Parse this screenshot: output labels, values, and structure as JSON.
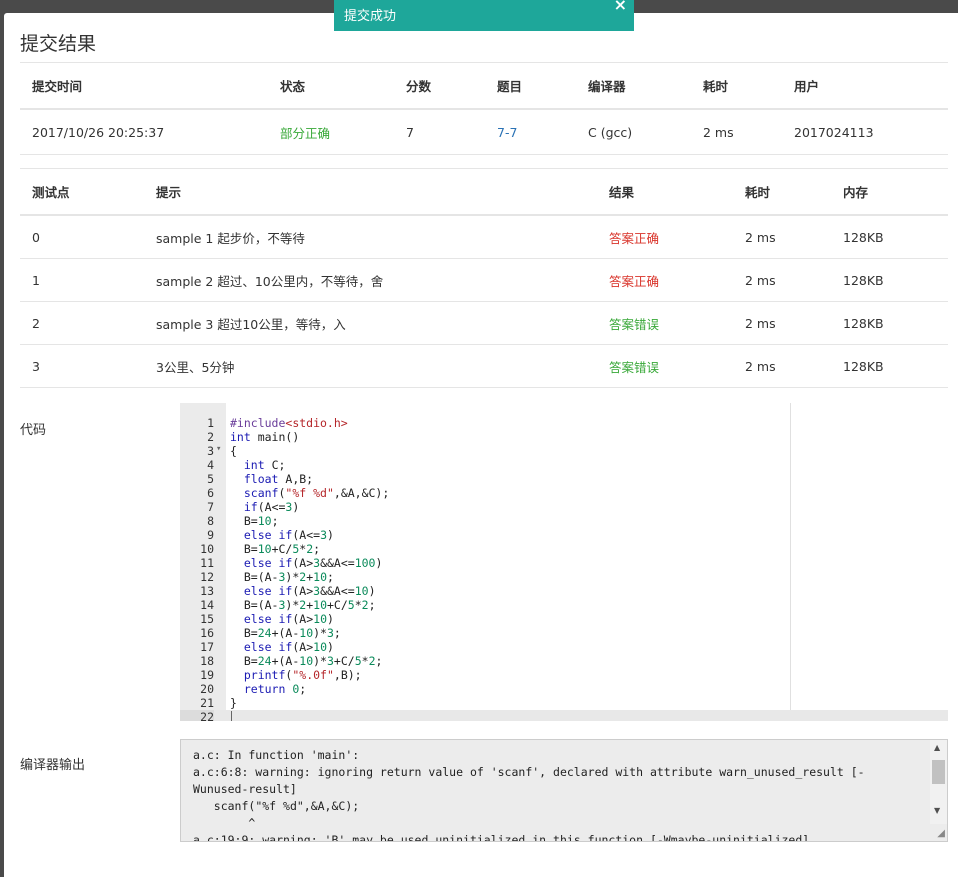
{
  "toast": {
    "text": "提交成功",
    "close": "×"
  },
  "title": "提交结果",
  "summary": {
    "headers": [
      "提交时间",
      "状态",
      "分数",
      "题目",
      "编译器",
      "耗时",
      "用户"
    ],
    "row": {
      "time": "2017/10/26 20:25:37",
      "status": "部分正确",
      "score": "7",
      "problem": "7-7",
      "compiler": "C (gcc)",
      "duration": "2 ms",
      "user": "2017024113"
    }
  },
  "tests": {
    "headers": [
      "测试点",
      "提示",
      "结果",
      "耗时",
      "内存"
    ],
    "rows": [
      {
        "id": "0",
        "hint": "sample 1 起步价，不等待",
        "result": "答案正确",
        "time": "2 ms",
        "mem": "128KB"
      },
      {
        "id": "1",
        "hint": "sample 2 超过、10公里内，不等待，舍",
        "result": "答案正确",
        "time": "2 ms",
        "mem": "128KB"
      },
      {
        "id": "2",
        "hint": "sample 3 超过10公里，等待，入",
        "result": "答案错误",
        "time": "2 ms",
        "mem": "128KB"
      },
      {
        "id": "3",
        "hint": "3公里、5分钟",
        "result": "答案错误",
        "time": "2 ms",
        "mem": "128KB"
      }
    ]
  },
  "labels": {
    "code": "代码",
    "compiler_output": "编译器输出"
  },
  "code_lines": [
    "#include<stdio.h>",
    "int main()",
    "{",
    "  int C;",
    "  float A,B;",
    "  scanf(\"%f %d\",&A,&C);",
    "  if(A<=3)",
    "  B=10;",
    "  else if(A<=3)",
    "  B=10+C/5*2;",
    "  else if(A>3&&A<=100)",
    "  B=(A-3)*2+10;",
    "  else if(A>3&&A<=10)",
    "  B=(A-3)*2+10+C/5*2;",
    "  else if(A>10)",
    "  B=24+(A-10)*3;",
    "  else if(A>10)",
    "  B=24+(A-10)*3+C/5*2;",
    "  printf(\"%.0f\",B);",
    "  return 0;",
    "}",
    ""
  ],
  "compiler_output": "a.c: In function 'main':\na.c:6:8: warning: ignoring return value of 'scanf', declared with attribute warn_unused_result [-Wunused-result]\n   scanf(\"%f %d\",&A,&C);\n        ^\na.c:19:9: warning: 'B' may be used uninitialized in this function [-Wmaybe-uninitialized]",
  "colors": {
    "accent": "#1ea79a",
    "correct": "#d9342b",
    "wrong": "#38a838",
    "partial": "#38a838",
    "link": "#2a72b5"
  }
}
